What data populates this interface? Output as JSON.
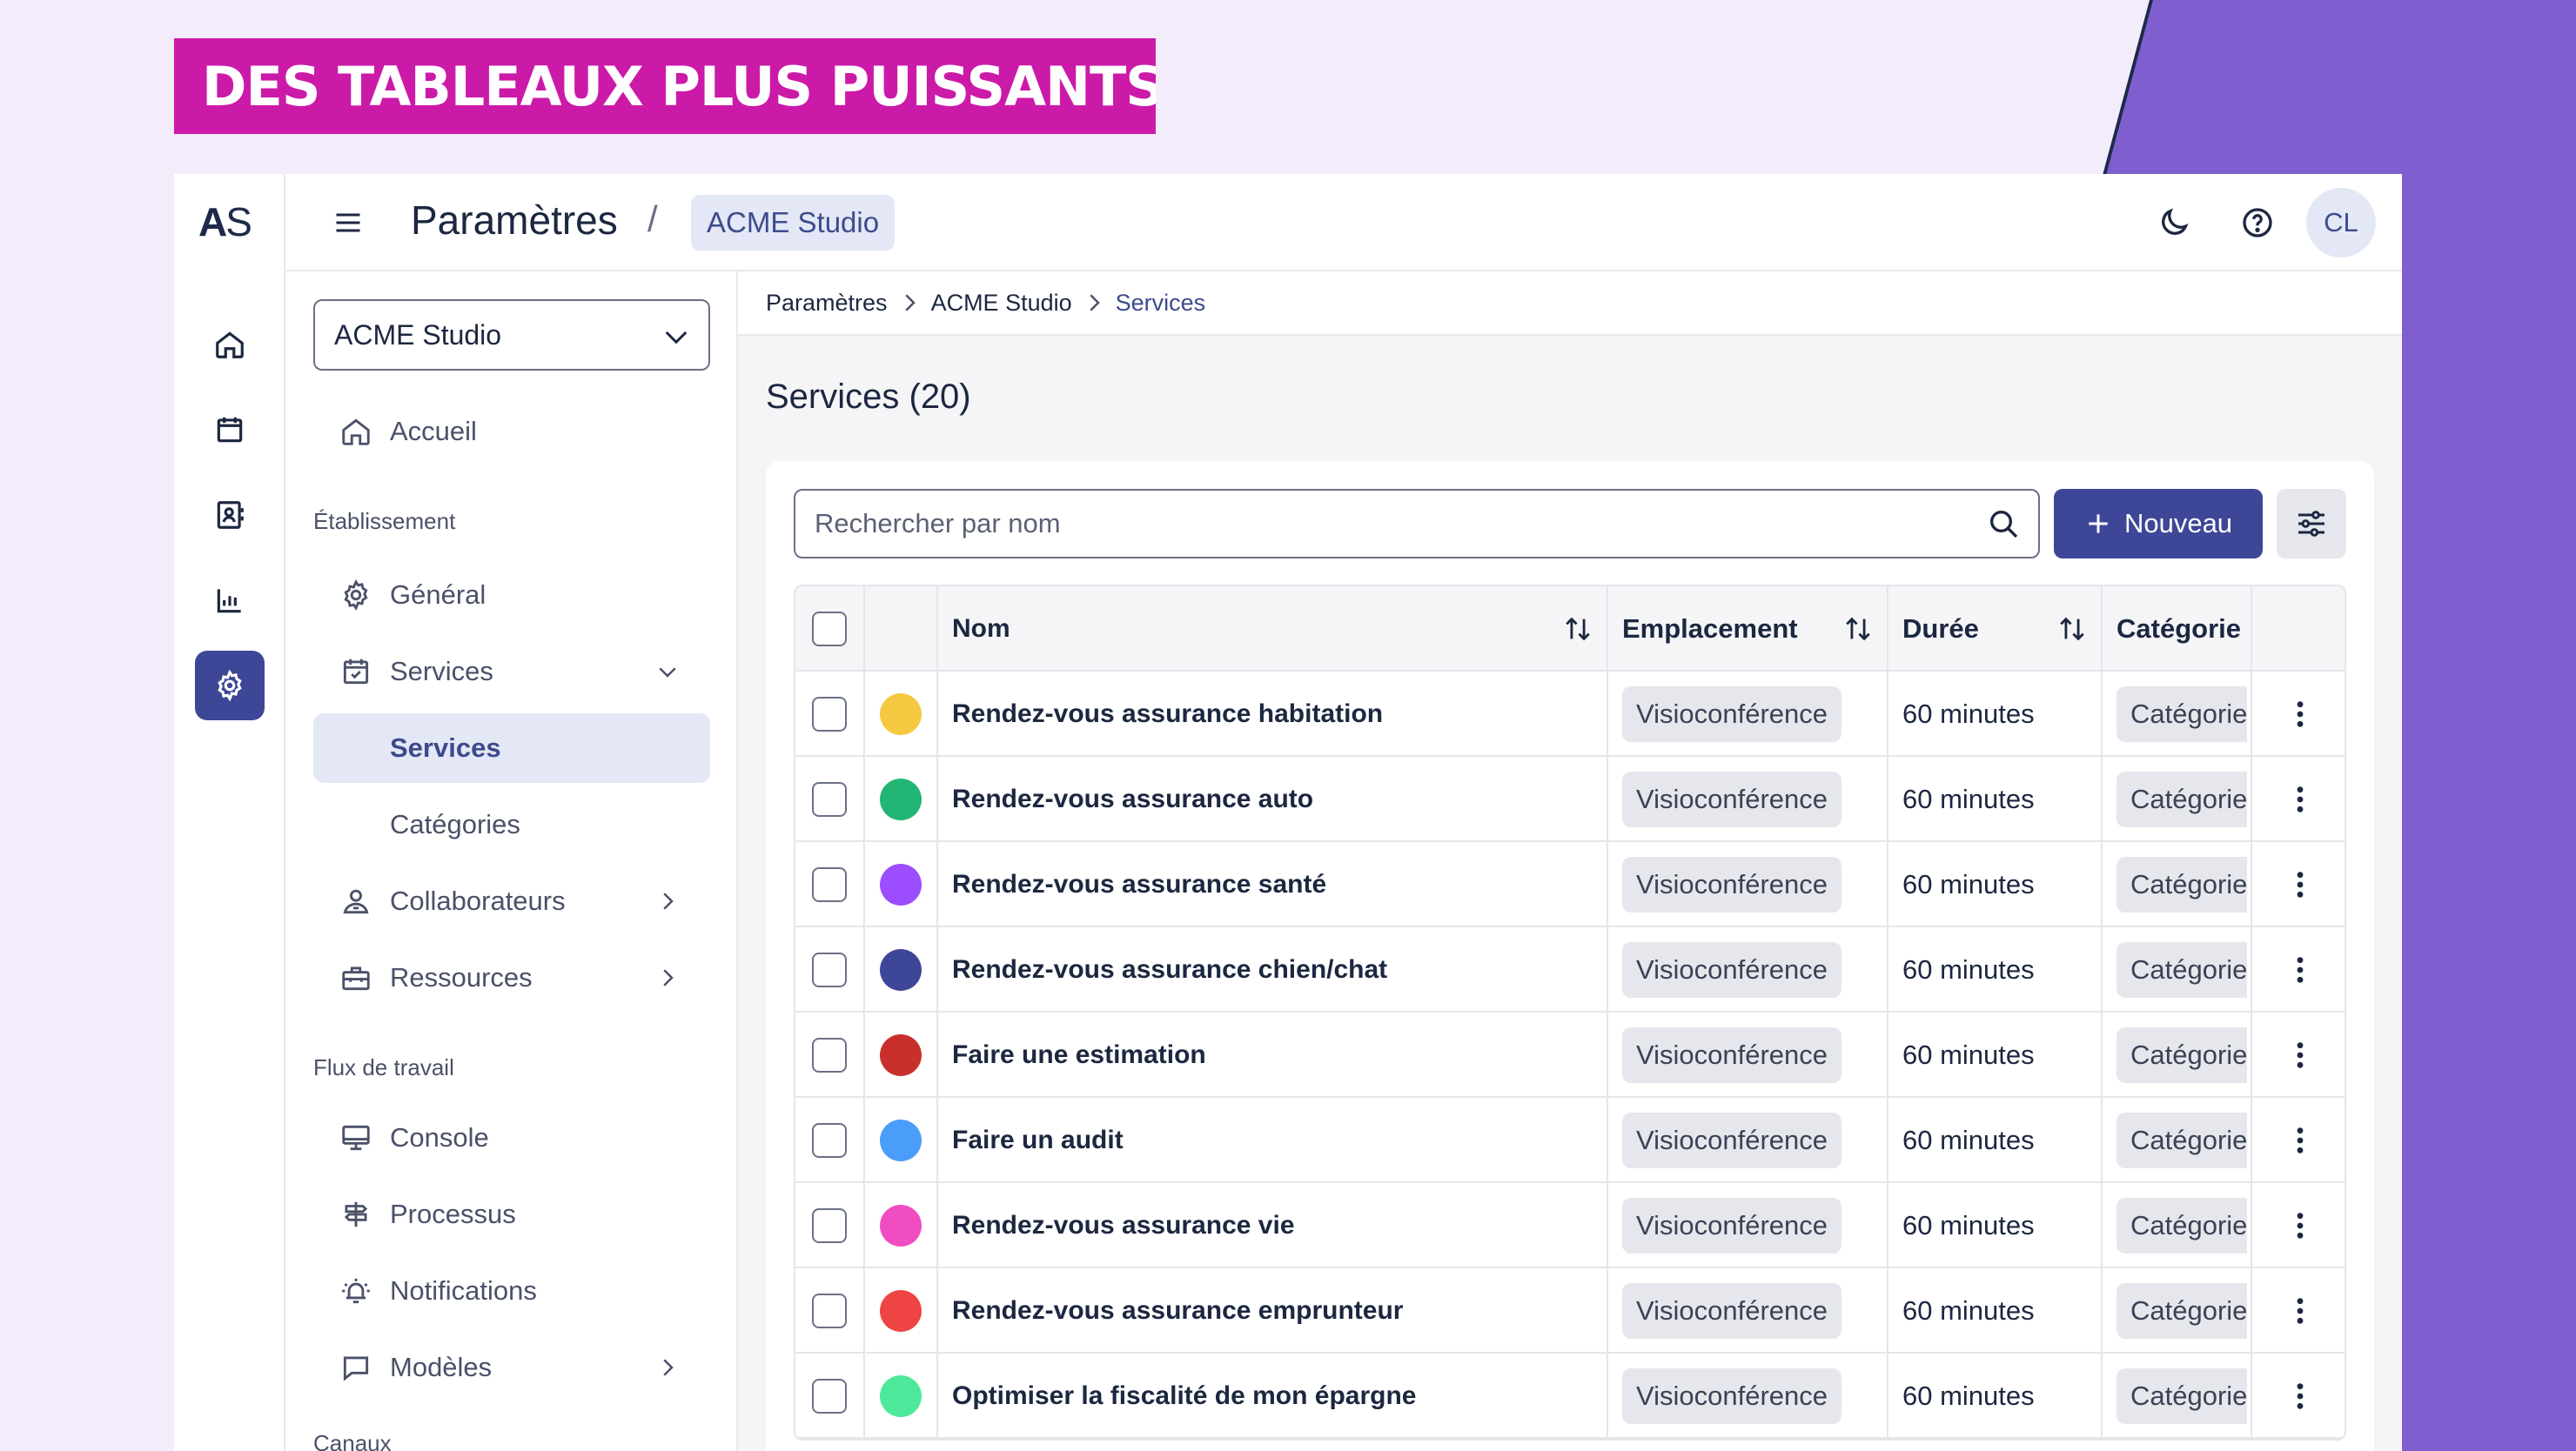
{
  "banner": {
    "text": "DES TABLEAUX PLUS PUISSANTS"
  },
  "colors": {
    "accent": "#3e4697",
    "banner": "#cc1aa8",
    "purple": "#7f5fcf",
    "navy": "#1e2a4a"
  },
  "rail": {
    "logo_a": "A",
    "logo_s": "S",
    "items": [
      {
        "icon": "home-icon"
      },
      {
        "icon": "calendar-icon"
      },
      {
        "icon": "contacts-icon"
      },
      {
        "icon": "chart-icon"
      },
      {
        "icon": "gear-icon",
        "active": true
      }
    ]
  },
  "topbar": {
    "title": "Paramètres",
    "slash": "/",
    "org": "ACME Studio",
    "avatar": "CL",
    "icons": [
      "moon-icon",
      "help-icon",
      "bell-icon"
    ]
  },
  "nav": {
    "select_value": "ACME Studio",
    "home": "Accueil",
    "section_etablissement": "Établissement",
    "general": "Général",
    "services": "Services",
    "services_sub": "Services",
    "categories": "Catégories",
    "collaborateurs": "Collaborateurs",
    "ressources": "Ressources",
    "section_flux": "Flux de travail",
    "console": "Console",
    "processus": "Processus",
    "notifications": "Notifications",
    "modeles": "Modèles",
    "section_canaux": "Canaux"
  },
  "breadcrumb": {
    "b1": "Paramètres",
    "b2": "ACME Studio",
    "b3": "Services"
  },
  "page": {
    "title": "Services (20)"
  },
  "toolbar": {
    "search_placeholder": "Rechercher par nom",
    "new_label": "Nouveau"
  },
  "table": {
    "headers": {
      "name": "Nom",
      "location": "Emplacement",
      "duration": "Durée",
      "category": "Catégorie"
    },
    "rows": [
      {
        "color": "#f5c842",
        "name": "Rendez-vous assurance habitation",
        "location": "Visioconférence",
        "duration": "60 minutes",
        "category": "Catégorie"
      },
      {
        "color": "#22b573",
        "name": "Rendez-vous assurance auto",
        "location": "Visioconférence",
        "duration": "60 minutes",
        "category": "Catégorie"
      },
      {
        "color": "#9b4dff",
        "name": "Rendez-vous assurance santé",
        "location": "Visioconférence",
        "duration": "60 minutes",
        "category": "Catégorie"
      },
      {
        "color": "#3e4697",
        "name": "Rendez-vous assurance chien/chat",
        "location": "Visioconférence",
        "duration": "60 minutes",
        "category": "Catégorie"
      },
      {
        "color": "#c9302c",
        "name": "Faire une estimation",
        "location": "Visioconférence",
        "duration": "60 minutes",
        "category": "Catégorie"
      },
      {
        "color": "#4a9df8",
        "name": "Faire un audit",
        "location": "Visioconférence",
        "duration": "60 minutes",
        "category": "Catégorie"
      },
      {
        "color": "#f04dc3",
        "name": "Rendez-vous assurance vie",
        "location": "Visioconférence",
        "duration": "60 minutes",
        "category": "Catégorie"
      },
      {
        "color": "#ef4444",
        "name": "Rendez-vous assurance emprunteur",
        "location": "Visioconférence",
        "duration": "60 minutes",
        "category": "Catégorie"
      },
      {
        "color": "#4ee89a",
        "name": "Optimiser la fiscalité de mon épargne",
        "location": "Visioconférence",
        "duration": "60 minutes",
        "category": "Catégorie"
      }
    ]
  }
}
